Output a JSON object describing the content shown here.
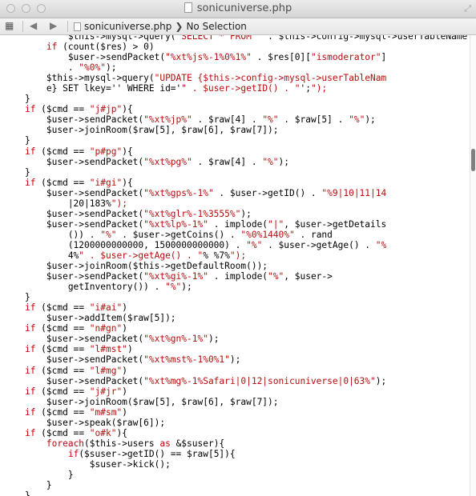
{
  "window": {
    "title": "sonicuniverse.php",
    "close_icon": "close-icon",
    "minimize_icon": "minimize-icon",
    "zoom_icon": "zoom-icon"
  },
  "navbar": {
    "grid_icon": "grid-icon",
    "back_icon": "back-arrow-icon",
    "forward_icon": "forward-arrow-icon",
    "file": "sonicuniverse.php",
    "chevron": "❯",
    "selection": "No Selection"
  },
  "colors": {
    "keyword": "#c4000d",
    "string": "#b70d0d",
    "text": "#000000"
  },
  "code_lines": [
    "            $this->mysql->query(\"SELECT * FROM \" . $this->config->mysql->userTableName . \" WHERE id='\" . $user->getID() . \"';\");",
    "        if (count($res) > 0)",
    "            $user->sendPacket(\"%xt%js%-1%0%1%\" . $res[0][\"ismoderator\"]",
    "            . \"%0%\");",
    "        $this->mysql->query(\"UPDATE {$this->config->mysql->userTableNam",
    "        e} SET lkey='' WHERE id='\" . $user->getID() . \"';\");",
    "    }",
    "    if ($cmd == \"j#jp\"){",
    "        $user->sendPacket(\"%xt%jp%\" . $raw[4] . \"%\" . $raw[5] . \"%\");",
    "        $user->joinRoom($raw[5], $raw[6], $raw[7]);",
    "    }",
    "    if ($cmd == \"p#pg\"){",
    "        $user->sendPacket(\"%xt%pg%\" . $raw[4] . \"%\");",
    "    }",
    "    if ($cmd == \"i#gi\"){",
    "        $user->sendPacket(\"%xt%gps%-1%\" . $user->getID() . \"%9|10|11|14",
    "            |20|183%\");",
    "        $user->sendPacket(\"%xt%glr%-1%3555%\");",
    "        $user->sendPacket(\"%xt%lp%-1%\" . implode(\"|\", $user->getDetails",
    "            ()) . \"%\" . $user->getCoins() . \"%0%1440%\" . rand",
    "            (1200000000000, 1500000000000) . \"%\" . $user->getAge() . \"%",
    "            4%\" . $user->getAge() . \"% %7%\");",
    "        $user->joinRoom($this->getDefaultRoom());",
    "        $user->sendPacket(\"%xt%gi%-1%\" . implode(\"%\", $user->",
    "            getInventory()) . \"%\");",
    "    }",
    "    if ($cmd == \"i#ai\")",
    "        $user->addItem($raw[5]);",
    "    if ($cmd == \"n#gn\")",
    "        $user->sendPacket(\"%xt%gn%-1%\");",
    "    if ($cmd == \"l#mst\")",
    "        $user->sendPacket(\"%xt%mst%-1%0%1\");",
    "    if ($cmd == \"l#mg\")",
    "        $user->sendPacket(\"%xt%mg%-1%Safari|0|12|sonicuniverse|0|63%\");",
    "    if ($cmd == \"j#jr\")",
    "        $user->joinRoom($raw[5], $raw[6], $raw[7]);",
    "    if ($cmd == \"m#sm\")",
    "        $user->speak($raw[6]);",
    "    if ($cmd == \"o#k\"){",
    "        foreach($this->users as &$suser){",
    "            if($suser->getID() == $raw[5]){",
    "                $suser->kick();",
    "            }",
    "        }",
    "    }",
    "}"
  ]
}
